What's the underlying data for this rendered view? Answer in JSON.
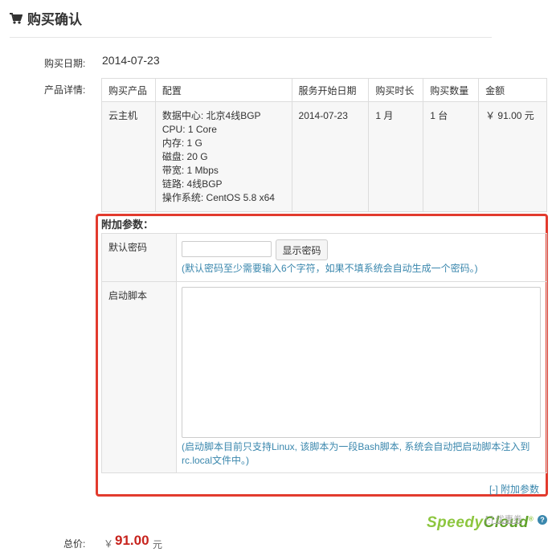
{
  "page": {
    "title": "购买确认",
    "title_icon": "shopping-cart-icon"
  },
  "purchase_date": {
    "label": "购买日期:",
    "value": "2014-07-23"
  },
  "product_details": {
    "label": "产品详情:",
    "headers": [
      "购买产品",
      "配置",
      "服务开始日期",
      "购买时长",
      "购买数量",
      "金额"
    ],
    "row": {
      "product": "云主机",
      "config": [
        "数据中心: 北京4线BGP",
        "CPU: 1 Core",
        "内存: 1 G",
        "磁盘: 20 G",
        "带宽: 1 Mbps",
        "链路: 4线BGP",
        "操作系统: CentOS 5.8 x64"
      ],
      "start_date": "2014-07-23",
      "duration": "1 月",
      "quantity": "1 台",
      "amount": "￥ 91.00 元"
    }
  },
  "addon": {
    "title": "附加参数：",
    "password": {
      "label": "默认密码",
      "value": "",
      "placeholder": "",
      "button": "显示密码",
      "hint": "(默认密码至少需要输入6个字符，如果不填系统会自动生成一个密码。)"
    },
    "script": {
      "label": "启动脚本",
      "value": "",
      "hint_line1": "(启动脚本目前只支持Linux, 该脚本为一段Bash脚本, 系统会自动把启动脚本注入到",
      "hint_line2": "rc.local文件中。)"
    },
    "toggle": "[-] 附加参数",
    "highlight_color": "#e23b2e"
  },
  "promo": {
    "text": "[-] 优惠券",
    "help": "?"
  },
  "watermark": {
    "part1": "Speedy",
    "part2": "Cloud",
    "mark": "®"
  },
  "total": {
    "label": "总价:",
    "currency": "￥",
    "amount": "91.00",
    "unit": "元"
  },
  "colors": {
    "link": "#3a87ad",
    "price": "#c7231d",
    "brand_green": "#8dc63f"
  }
}
